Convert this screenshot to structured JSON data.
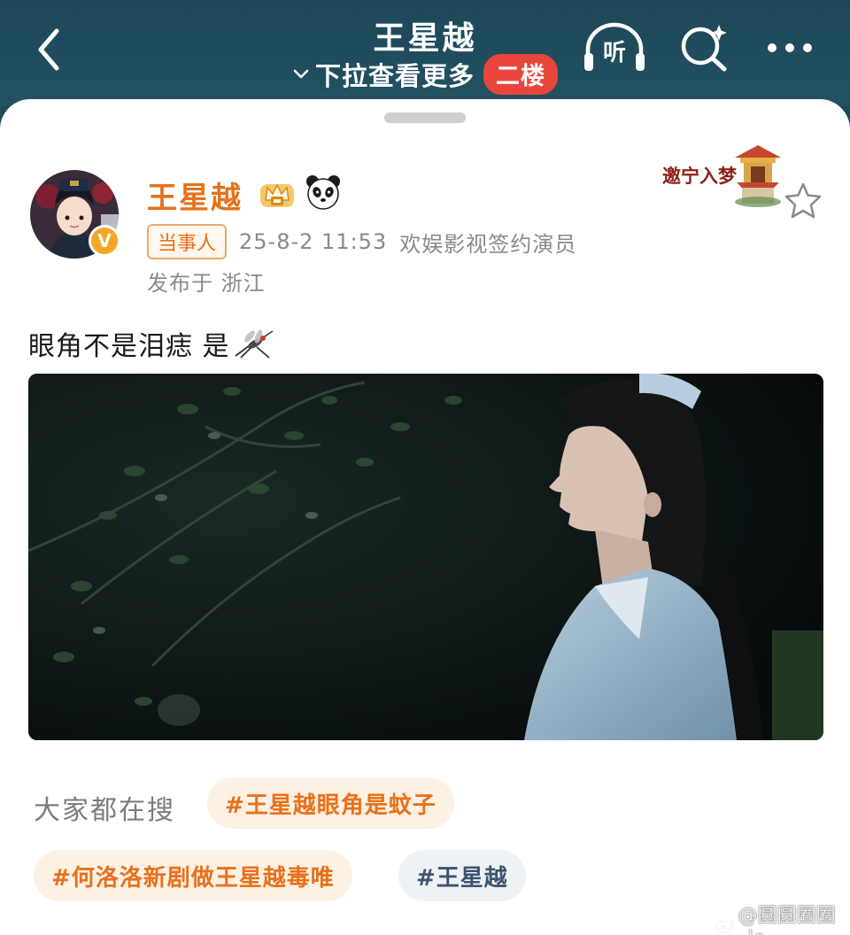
{
  "header": {
    "title": "王星越",
    "pull_hint": "下拉查看更多",
    "floor_badge": "二楼",
    "listen_label": "听"
  },
  "post": {
    "author": "王星越",
    "role_tag": "当事人",
    "time": "25-8-2 11:53",
    "source": "欢娱影视签约演员",
    "location": "发布于 浙江",
    "text": "眼角不是泪痣 是",
    "decoration_text": "邀宁入梦"
  },
  "related": {
    "label": "大家都在搜",
    "tags": [
      "#王星越眼角是蚊子",
      "#何洛洛新剧做王星越毒唯",
      "#王星越"
    ]
  },
  "watermark": "@圆圆圈圈_le",
  "colors": {
    "header_bg": "#1e4a5a",
    "accent_orange": "#e8711c",
    "badge_red": "#e8463c",
    "verified_gold": "#f5a623"
  }
}
